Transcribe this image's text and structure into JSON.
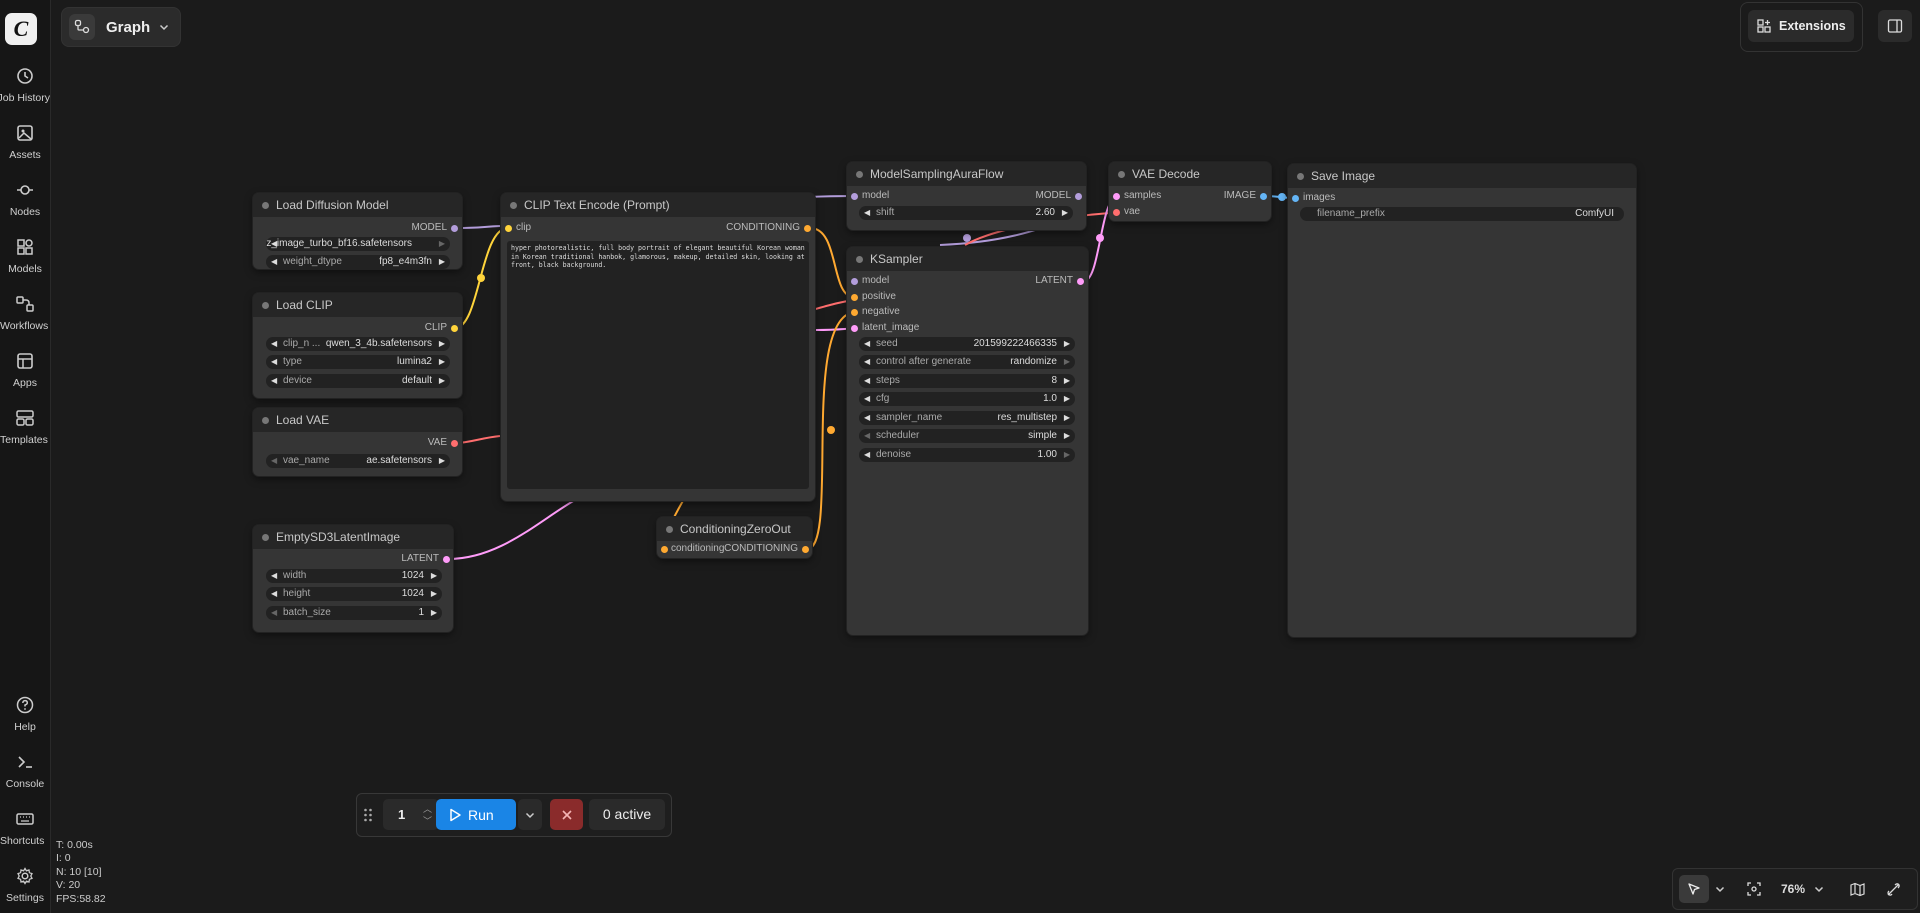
{
  "app": {
    "graph_label": "Graph",
    "extensions_label": "Extensions"
  },
  "sidebar": {
    "items": [
      {
        "label": "Job History",
        "icon": "history-icon"
      },
      {
        "label": "Assets",
        "icon": "image-icon"
      },
      {
        "label": "Nodes",
        "icon": "nodes-icon"
      },
      {
        "label": "Models",
        "icon": "models-icon"
      },
      {
        "label": "Workflows",
        "icon": "workflows-icon"
      },
      {
        "label": "Apps",
        "icon": "apps-icon"
      },
      {
        "label": "Templates",
        "icon": "templates-icon"
      }
    ],
    "bottom": [
      {
        "label": "Help",
        "icon": "help-icon"
      },
      {
        "label": "Console",
        "icon": "console-icon"
      },
      {
        "label": "Shortcuts",
        "icon": "keyboard-icon"
      },
      {
        "label": "Settings",
        "icon": "gear-icon"
      }
    ]
  },
  "nodes": {
    "load_diffusion": {
      "title": "Load Diffusion Model",
      "output": "MODEL",
      "unet_name": "z_image_turbo_bf16.safetensors",
      "weight_dtype_label": "weight_dtype",
      "weight_dtype": "fp8_e4m3fn"
    },
    "load_clip": {
      "title": "Load CLIP",
      "output": "CLIP",
      "clip_name_label": "clip_n ...",
      "clip_name": "qwen_3_4b.safetensors",
      "type_label": "type",
      "type": "lumina2",
      "device_label": "device",
      "device": "default"
    },
    "load_vae": {
      "title": "Load VAE",
      "output": "VAE",
      "vae_name_label": "vae_name",
      "vae_name": "ae.safetensors"
    },
    "empty_latent": {
      "title": "EmptySD3LatentImage",
      "output": "LATENT",
      "width_label": "width",
      "width": "1024",
      "height_label": "height",
      "height": "1024",
      "batch_label": "batch_size",
      "batch": "1"
    },
    "clip_encode": {
      "title": "CLIP Text Encode (Prompt)",
      "input": "clip",
      "output": "CONDITIONING",
      "text": "hyper photorealistic, full body portrait of elegant beautiful Korean woman in Korean traditional hanbok, glamorous, makeup, detailed skin, looking at front, black background."
    },
    "cond_zero": {
      "title": "ConditioningZeroOut",
      "input": "conditioning",
      "output": "CONDITIONING"
    },
    "model_sampling": {
      "title": "ModelSamplingAuraFlow",
      "input": "model",
      "output": "MODEL",
      "shift_label": "shift",
      "shift": "2.60"
    },
    "ksampler": {
      "title": "KSampler",
      "inputs": [
        "model",
        "positive",
        "negative",
        "latent_image"
      ],
      "output": "LATENT",
      "seed_label": "seed",
      "seed": "201599222466335",
      "control_label": "control after generate",
      "control": "randomize",
      "steps_label": "steps",
      "steps": "8",
      "cfg_label": "cfg",
      "cfg": "1.0",
      "sampler_label": "sampler_name",
      "sampler": "res_multistep",
      "scheduler_label": "scheduler",
      "scheduler": "simple",
      "denoise_label": "denoise",
      "denoise": "1.00"
    },
    "vae_decode": {
      "title": "VAE Decode",
      "input_samples": "samples",
      "input_vae": "vae",
      "output": "IMAGE"
    },
    "save_image": {
      "title": "Save Image",
      "input": "images",
      "prefix_label": "filename_prefix",
      "prefix": "ComfyUI"
    }
  },
  "runbar": {
    "quantity": "1",
    "run_label": "Run",
    "active_label": "0 active"
  },
  "stats": {
    "t": "T: 0.00s",
    "i": "I: 0",
    "n": "N: 10 [10]",
    "v": "V: 20",
    "fps": "FPS:58.82"
  },
  "canvas": {
    "zoom": "76%"
  },
  "colors": {
    "model": "#b39ddb",
    "clip": "#ffd43b",
    "conditioning": "#ffa931",
    "vae": "#ff6e6e",
    "latent": "#ff9cf9",
    "image": "#64b5f6",
    "accent": "#1a85e6"
  }
}
